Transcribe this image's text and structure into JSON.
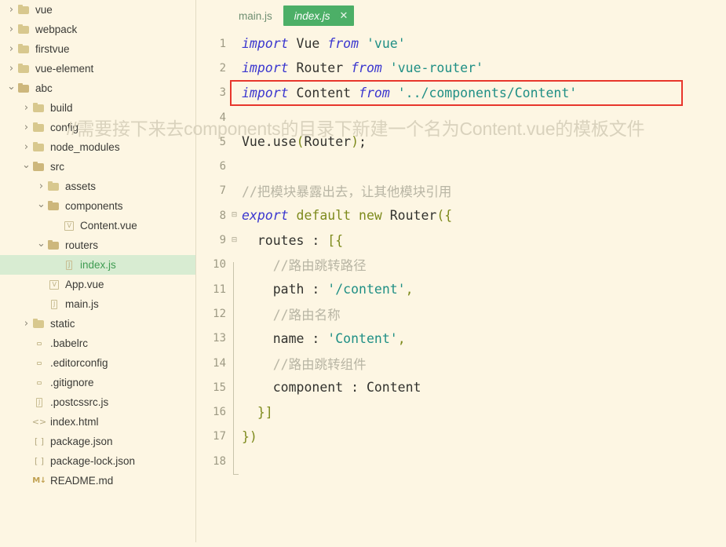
{
  "colors": {
    "background": "#fdf6e3",
    "selected_row": "#d8ecd2",
    "active_tab": "#4caf67",
    "highlight_box": "#e8362c",
    "folder_icon": "#d8c88e",
    "keyword": "#3b37cf",
    "string": "#1f8f85",
    "comment": "#b8b5a4",
    "operator": "#7d8a1c",
    "lineno": "#9e9a84"
  },
  "sidebar": {
    "items": [
      {
        "label": "vue",
        "indent": 0,
        "type": "folder",
        "state": "collapsed",
        "icon": "folder-icon",
        "selected": false
      },
      {
        "label": "webpack",
        "indent": 0,
        "type": "folder",
        "state": "collapsed",
        "icon": "folder-icon",
        "selected": false
      },
      {
        "label": "firstvue",
        "indent": 0,
        "type": "folder",
        "state": "collapsed",
        "icon": "folder-icon",
        "selected": false
      },
      {
        "label": "vue-element",
        "indent": 0,
        "type": "folder",
        "state": "collapsed",
        "icon": "folder-icon",
        "selected": false
      },
      {
        "label": "abc",
        "indent": 0,
        "type": "folder",
        "state": "expanded",
        "icon": "folder-open-icon",
        "selected": false
      },
      {
        "label": "build",
        "indent": 1,
        "type": "folder",
        "state": "collapsed",
        "icon": "folder-icon",
        "selected": false
      },
      {
        "label": "config",
        "indent": 1,
        "type": "folder",
        "state": "collapsed",
        "icon": "folder-icon",
        "selected": false
      },
      {
        "label": "node_modules",
        "indent": 1,
        "type": "folder",
        "state": "collapsed",
        "icon": "folder-icon",
        "selected": false
      },
      {
        "label": "src",
        "indent": 1,
        "type": "folder",
        "state": "expanded",
        "icon": "folder-open-icon",
        "selected": false
      },
      {
        "label": "assets",
        "indent": 2,
        "type": "folder",
        "state": "collapsed",
        "icon": "folder-icon",
        "selected": false
      },
      {
        "label": "components",
        "indent": 2,
        "type": "folder",
        "state": "expanded",
        "icon": "folder-open-icon",
        "selected": false
      },
      {
        "label": "Content.vue",
        "indent": 3,
        "type": "file",
        "glyph": "V",
        "iconstyle": "box",
        "icon": "vue-file-icon",
        "selected": false
      },
      {
        "label": "routers",
        "indent": 2,
        "type": "folder",
        "state": "expanded",
        "icon": "folder-open-icon",
        "selected": false
      },
      {
        "label": "index.js",
        "indent": 3,
        "type": "file",
        "glyph": "J",
        "iconstyle": "box",
        "icon": "js-file-icon",
        "selected": true
      },
      {
        "label": "App.vue",
        "indent": 2,
        "type": "file",
        "glyph": "V",
        "iconstyle": "box",
        "icon": "vue-file-icon",
        "selected": false
      },
      {
        "label": "main.js",
        "indent": 2,
        "type": "file",
        "glyph": "J",
        "iconstyle": "box",
        "icon": "js-file-icon",
        "selected": false
      },
      {
        "label": "static",
        "indent": 1,
        "type": "folder",
        "state": "collapsed",
        "icon": "folder-icon",
        "selected": false
      },
      {
        "label": ".babelrc",
        "indent": 1,
        "type": "file",
        "glyph": " ",
        "iconstyle": "plain",
        "icon": "generic-file-icon",
        "selected": false
      },
      {
        "label": ".editorconfig",
        "indent": 1,
        "type": "file",
        "glyph": " ",
        "iconstyle": "plain",
        "icon": "generic-file-icon",
        "selected": false
      },
      {
        "label": ".gitignore",
        "indent": 1,
        "type": "file",
        "glyph": " ",
        "iconstyle": "plain",
        "icon": "generic-file-icon",
        "selected": false
      },
      {
        "label": ".postcssrc.js",
        "indent": 1,
        "type": "file",
        "glyph": "J",
        "iconstyle": "box",
        "icon": "js-file-icon",
        "selected": false
      },
      {
        "label": "index.html",
        "indent": 1,
        "type": "file",
        "glyph": "<>",
        "iconstyle": "code",
        "icon": "html-file-icon",
        "selected": false
      },
      {
        "label": "package.json",
        "indent": 1,
        "type": "file",
        "glyph": "[ ]",
        "iconstyle": "code",
        "icon": "json-file-icon",
        "selected": false
      },
      {
        "label": "package-lock.json",
        "indent": 1,
        "type": "file",
        "glyph": "[ ]",
        "iconstyle": "code",
        "icon": "json-file-icon",
        "selected": false
      },
      {
        "label": "README.md",
        "indent": 1,
        "type": "file",
        "glyph": "M↓",
        "iconstyle": "md",
        "icon": "markdown-file-icon",
        "selected": false
      }
    ]
  },
  "tabs": [
    {
      "label": "main.js",
      "active": false,
      "closable": false,
      "close_label": ""
    },
    {
      "label": "index.js",
      "active": true,
      "closable": true,
      "close_label": "✕"
    }
  ],
  "editor": {
    "watermark": "//需要接下来去components的目录下新建一个名为Content.vue的模板文件",
    "highlighted_line": 3,
    "lines": [
      {
        "no": "1",
        "fold": "",
        "tokens": [
          {
            "t": "kw",
            "v": "import"
          },
          {
            "t": "id",
            "v": " Vue "
          },
          {
            "t": "kw",
            "v": "from"
          },
          {
            "t": "id",
            "v": " "
          },
          {
            "t": "str",
            "v": "'vue'"
          }
        ]
      },
      {
        "no": "2",
        "fold": "",
        "tokens": [
          {
            "t": "kw",
            "v": "import"
          },
          {
            "t": "id",
            "v": " Router "
          },
          {
            "t": "kw",
            "v": "from"
          },
          {
            "t": "id",
            "v": " "
          },
          {
            "t": "str",
            "v": "'vue-router'"
          }
        ]
      },
      {
        "no": "3",
        "fold": "",
        "tokens": [
          {
            "t": "kw",
            "v": "import"
          },
          {
            "t": "id",
            "v": " Content "
          },
          {
            "t": "kw",
            "v": "from"
          },
          {
            "t": "id",
            "v": " "
          },
          {
            "t": "str",
            "v": "'../components/Content'"
          }
        ]
      },
      {
        "no": "4",
        "fold": "",
        "tokens": [
          {
            "t": "id",
            "v": ""
          }
        ]
      },
      {
        "no": "5",
        "fold": "",
        "tokens": [
          {
            "t": "id",
            "v": "Vue."
          },
          {
            "t": "fn",
            "v": "use"
          },
          {
            "t": "op",
            "v": "("
          },
          {
            "t": "id",
            "v": "Router"
          },
          {
            "t": "op",
            "v": ")"
          },
          {
            "t": "pun",
            "v": ";"
          }
        ]
      },
      {
        "no": "6",
        "fold": "",
        "tokens": [
          {
            "t": "id",
            "v": ""
          }
        ]
      },
      {
        "no": "7",
        "fold": "",
        "tokens": [
          {
            "t": "com",
            "v": "//把模块暴露出去，让其他模块引用"
          }
        ]
      },
      {
        "no": "8",
        "fold": "minus",
        "tokens": [
          {
            "t": "kw",
            "v": "export"
          },
          {
            "t": "op",
            "v": " default new "
          },
          {
            "t": "id",
            "v": "Router"
          },
          {
            "t": "op",
            "v": "({"
          }
        ]
      },
      {
        "no": "9",
        "fold": "minus",
        "tokens": [
          {
            "t": "id",
            "v": "  routes : "
          },
          {
            "t": "op",
            "v": "[{"
          }
        ]
      },
      {
        "no": "10",
        "fold": "bar",
        "tokens": [
          {
            "t": "com",
            "v": "    //路由跳转路径"
          }
        ]
      },
      {
        "no": "11",
        "fold": "bar",
        "tokens": [
          {
            "t": "id",
            "v": "    path : "
          },
          {
            "t": "str",
            "v": "'/content'"
          },
          {
            "t": "op",
            "v": ","
          }
        ]
      },
      {
        "no": "12",
        "fold": "bar",
        "tokens": [
          {
            "t": "com",
            "v": "    //路由名称"
          }
        ]
      },
      {
        "no": "13",
        "fold": "bar",
        "tokens": [
          {
            "t": "id",
            "v": "    name : "
          },
          {
            "t": "str",
            "v": "'Content'"
          },
          {
            "t": "op",
            "v": ","
          }
        ]
      },
      {
        "no": "14",
        "fold": "bar",
        "tokens": [
          {
            "t": "com",
            "v": "    //路由跳转组件"
          }
        ]
      },
      {
        "no": "15",
        "fold": "bar",
        "tokens": [
          {
            "t": "id",
            "v": "    component : Content"
          }
        ]
      },
      {
        "no": "16",
        "fold": "bar",
        "tokens": [
          {
            "t": "op",
            "v": "  }]"
          }
        ]
      },
      {
        "no": "17",
        "fold": "bar",
        "tokens": [
          {
            "t": "op",
            "v": "})"
          }
        ]
      },
      {
        "no": "18",
        "fold": "barend",
        "tokens": [
          {
            "t": "id",
            "v": ""
          }
        ]
      }
    ]
  }
}
